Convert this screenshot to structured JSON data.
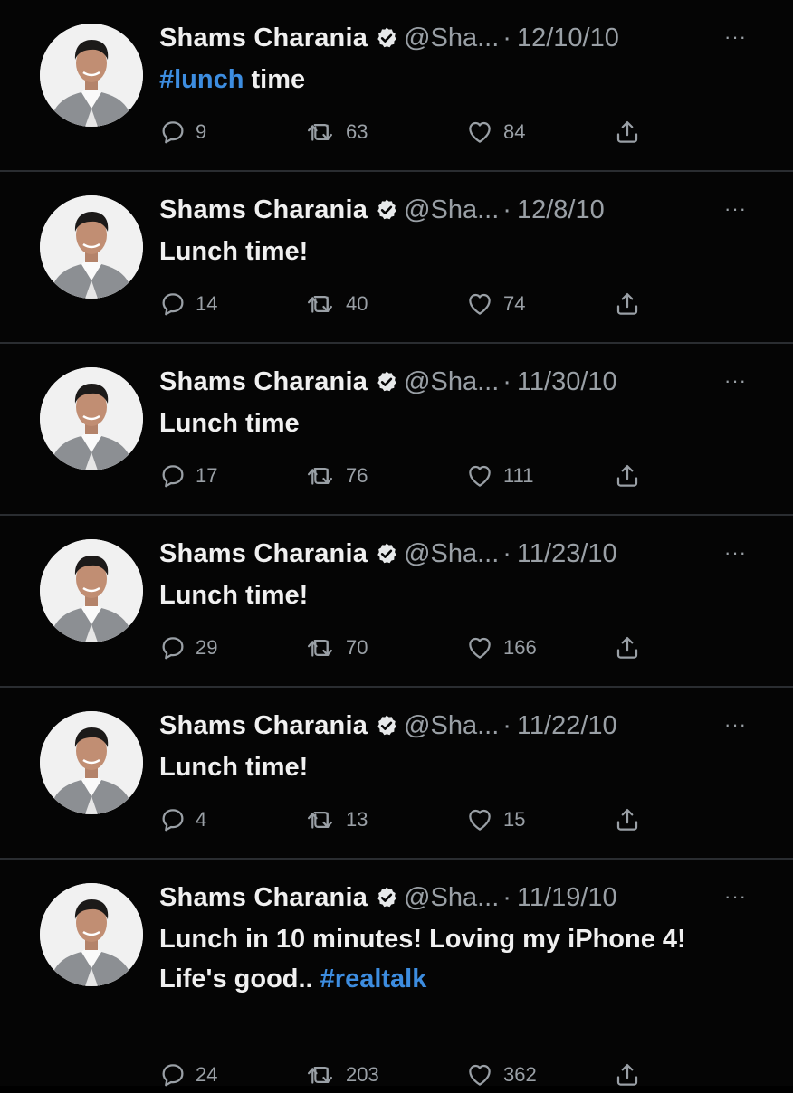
{
  "tweets": [
    {
      "name": "Shams Charania",
      "handle": "@Sha...",
      "dot": "·",
      "date": "12/10/10",
      "text_parts": [
        {
          "text": "#lunch",
          "hashtag": true
        },
        {
          "text": " time",
          "hashtag": false
        }
      ],
      "replies": "9",
      "retweets": "63",
      "likes": "84"
    },
    {
      "name": "Shams Charania",
      "handle": "@Sha...",
      "dot": "·",
      "date": "12/8/10",
      "text_parts": [
        {
          "text": "Lunch time!",
          "hashtag": false
        }
      ],
      "replies": "14",
      "retweets": "40",
      "likes": "74"
    },
    {
      "name": "Shams Charania",
      "handle": "@Sha...",
      "dot": "·",
      "date": "11/30/10",
      "text_parts": [
        {
          "text": "Lunch time",
          "hashtag": false
        }
      ],
      "replies": "17",
      "retweets": "76",
      "likes": "111"
    },
    {
      "name": "Shams Charania",
      "handle": "@Sha...",
      "dot": "·",
      "date": "11/23/10",
      "text_parts": [
        {
          "text": "Lunch time!",
          "hashtag": false
        }
      ],
      "replies": "29",
      "retweets": "70",
      "likes": "166"
    },
    {
      "name": "Shams Charania",
      "handle": "@Sha...",
      "dot": "·",
      "date": "11/22/10",
      "text_parts": [
        {
          "text": "Lunch time!",
          "hashtag": false
        }
      ],
      "replies": "4",
      "retweets": "13",
      "likes": "15"
    },
    {
      "name": "Shams Charania",
      "handle": "@Sha...",
      "dot": "·",
      "date": "11/19/10",
      "text_parts": [
        {
          "text": "Lunch in 10 minutes! Loving my iPhone 4! Life's good.. ",
          "hashtag": false
        },
        {
          "text": "#realtalk",
          "hashtag": true
        }
      ],
      "replies": "24",
      "retweets": "203",
      "likes": "362"
    }
  ],
  "more_label": "···",
  "icons": {
    "verified": "verified-badge-icon",
    "reply": "reply-icon",
    "retweet": "retweet-icon",
    "like": "heart-icon",
    "share": "share-icon",
    "more": "more-options-icon",
    "avatar": "avatar"
  },
  "colors": {
    "background": "#050505",
    "hashtag": "#3d8de0",
    "muted": "#9aa0a6",
    "text": "#f0f0f0",
    "divider": "#2a2d31"
  }
}
